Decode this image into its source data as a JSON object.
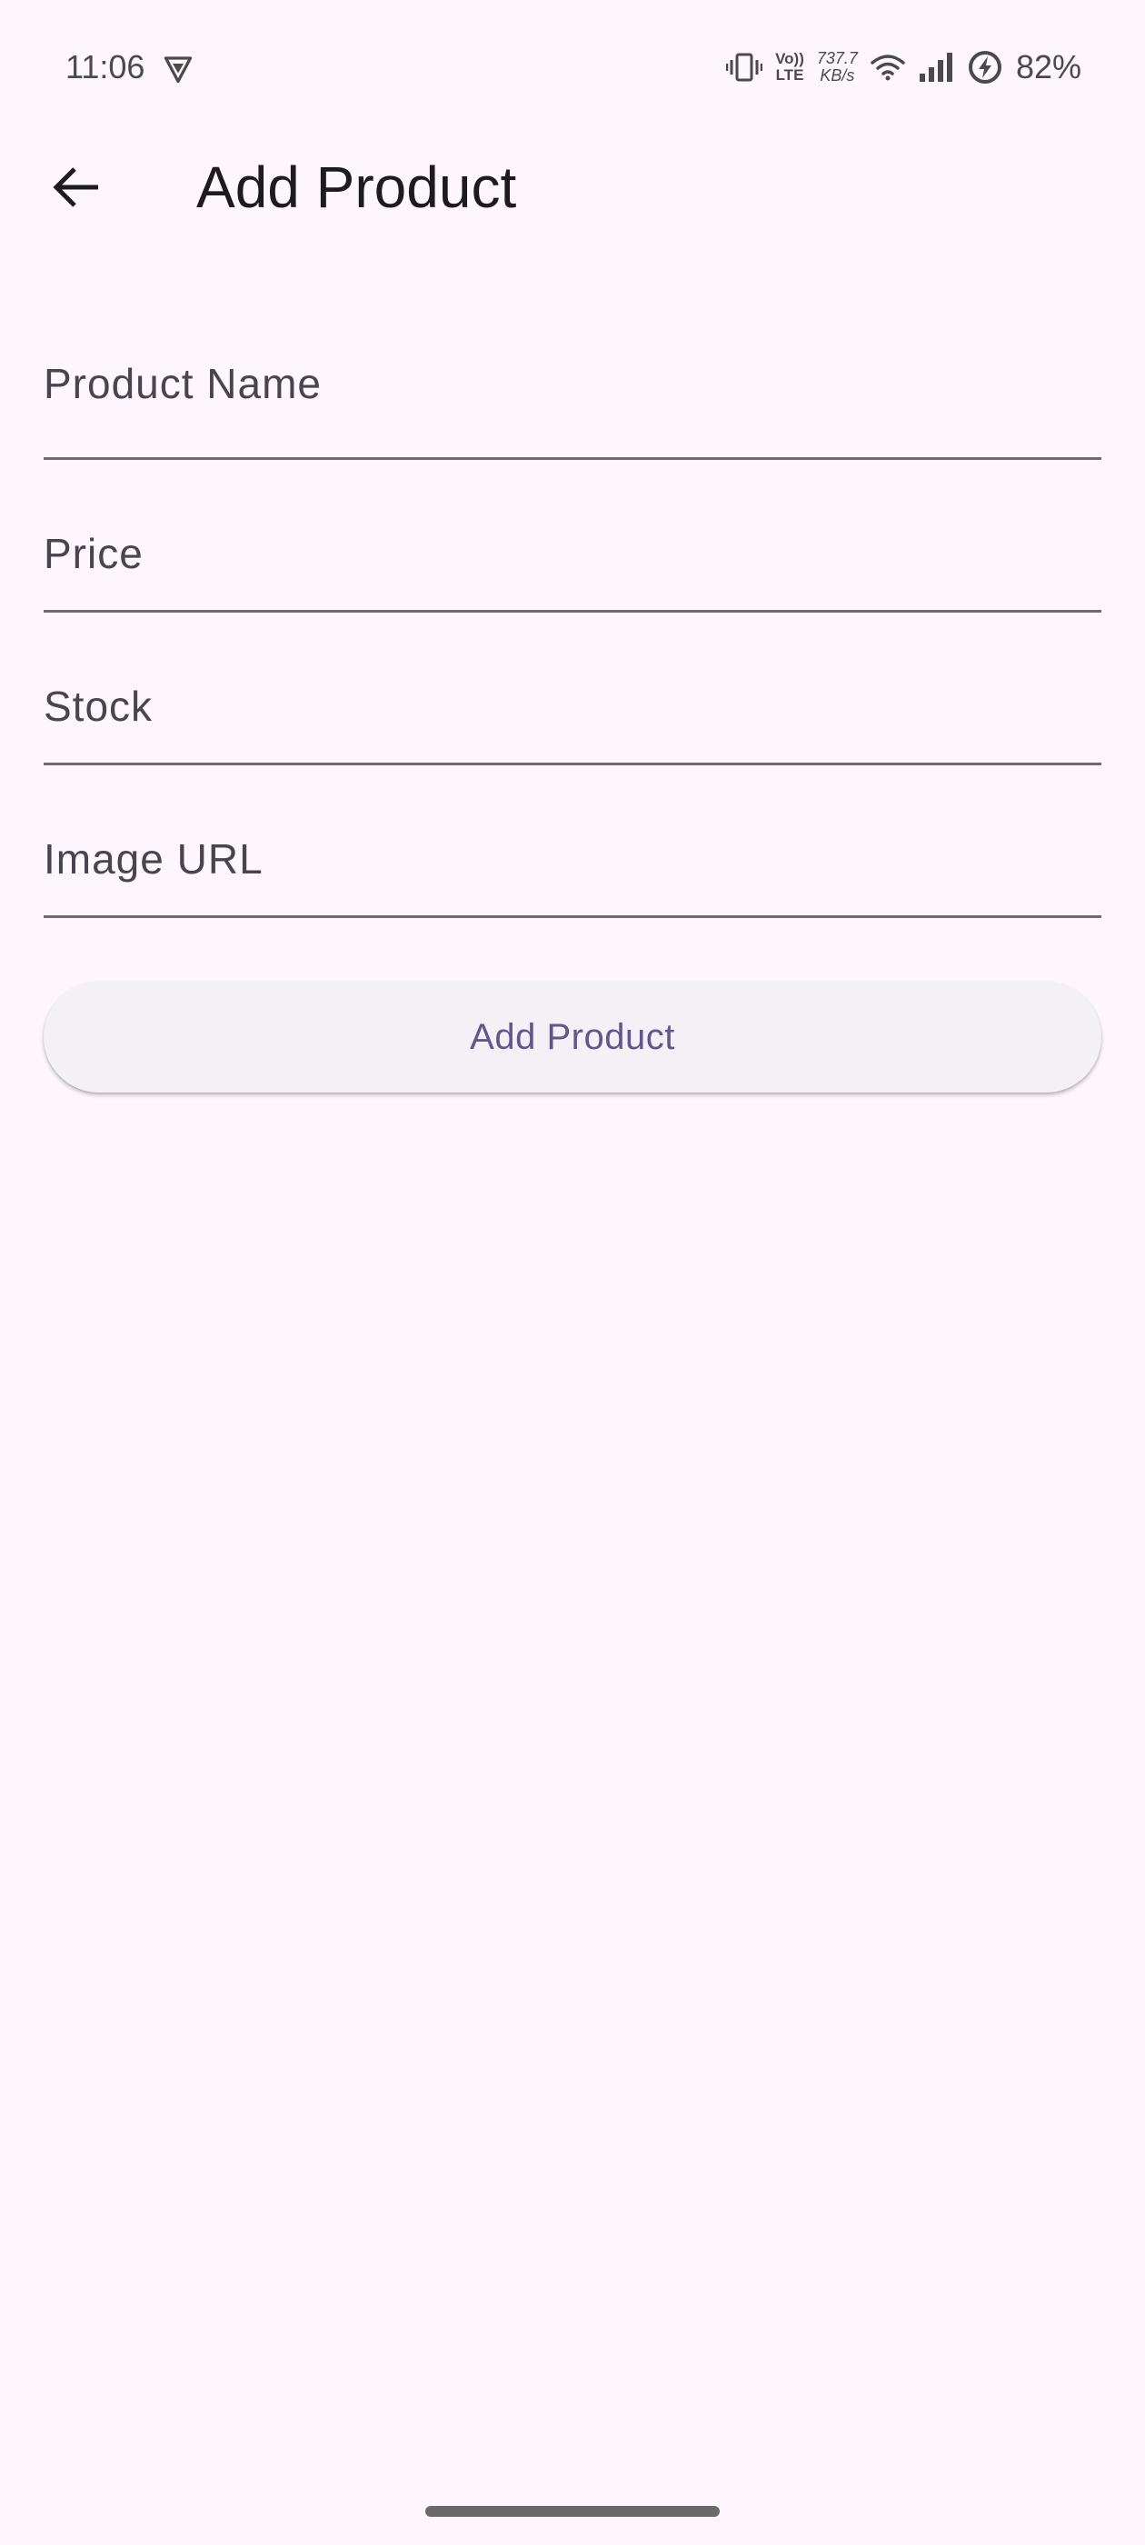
{
  "status_bar": {
    "time": "11:06",
    "volte_top": "Vo))",
    "volte_bottom": "LTE",
    "speed_value": "737.7",
    "speed_unit": "KB/s",
    "battery_percent": "82%",
    "icons": [
      "vpn-shield-icon",
      "vibrate-icon",
      "volte-icon",
      "wifi-icon",
      "cellular-signal-icon",
      "battery-charging-icon"
    ]
  },
  "app_bar": {
    "back_icon": "arrow-left-icon",
    "title": "Add Product"
  },
  "form": {
    "fields": [
      {
        "name": "product-name",
        "placeholder": "Product Name",
        "value": ""
      },
      {
        "name": "price",
        "placeholder": "Price",
        "value": ""
      },
      {
        "name": "stock",
        "placeholder": "Stock",
        "value": ""
      },
      {
        "name": "image-url",
        "placeholder": "Image URL",
        "value": ""
      }
    ],
    "submit_label": "Add Product"
  },
  "colors": {
    "background": "#fdf7fd",
    "title_text": "#1d1b20",
    "field_text": "#49454f",
    "underline": "#6f6b73",
    "button_background": "#f4f1f6",
    "button_text": "#65558f"
  }
}
